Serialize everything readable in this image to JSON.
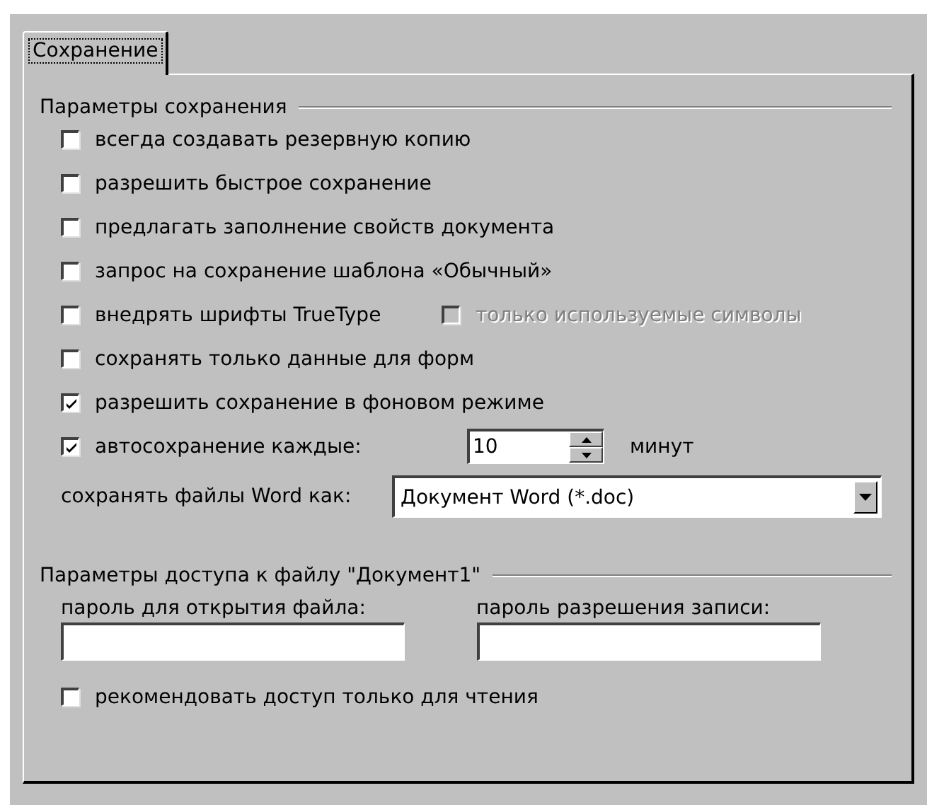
{
  "tabs": [
    {
      "label": "Сохранение",
      "selected": true
    }
  ],
  "save_options": {
    "title": "Параметры сохранения",
    "options": [
      {
        "kind": "checkbox",
        "label": "всегда создавать резервную копию",
        "checked": false
      },
      {
        "kind": "checkbox",
        "label": "разрешить быстрое сохранение",
        "checked": false
      },
      {
        "kind": "checkbox",
        "label": "предлагать заполнение свойств документа",
        "checked": false
      },
      {
        "kind": "checkbox",
        "label": "запрос на сохранение шаблона «Обычный»",
        "checked": false
      },
      {
        "kind": "checkbox",
        "label": "внедрять шрифты TrueType",
        "checked": false,
        "sub_option": {
          "label": "только используемые символы",
          "checked": false,
          "disabled": true
        }
      },
      {
        "kind": "checkbox",
        "label": "сохранять только данные для форм",
        "checked": false
      },
      {
        "kind": "checkbox",
        "label": "разрешить сохранение в фоновом режиме",
        "checked": true
      },
      {
        "kind": "spinner",
        "label": "автосохранение каждые:",
        "checked": true,
        "value": "10",
        "unit": "минут"
      },
      {
        "kind": "dropdown",
        "label": "сохранять файлы Word как:",
        "value": "Документ Word (*.doc)"
      }
    ]
  },
  "access": {
    "title": "Параметры доступа к файлу \"Документ1\"",
    "password_fields": [
      {
        "label": "пароль для открытия файла:"
      },
      {
        "label": "пароль разрешения записи:"
      }
    ],
    "read_only": {
      "label": "рекомендовать доступ только для чтения",
      "checked": false
    }
  }
}
